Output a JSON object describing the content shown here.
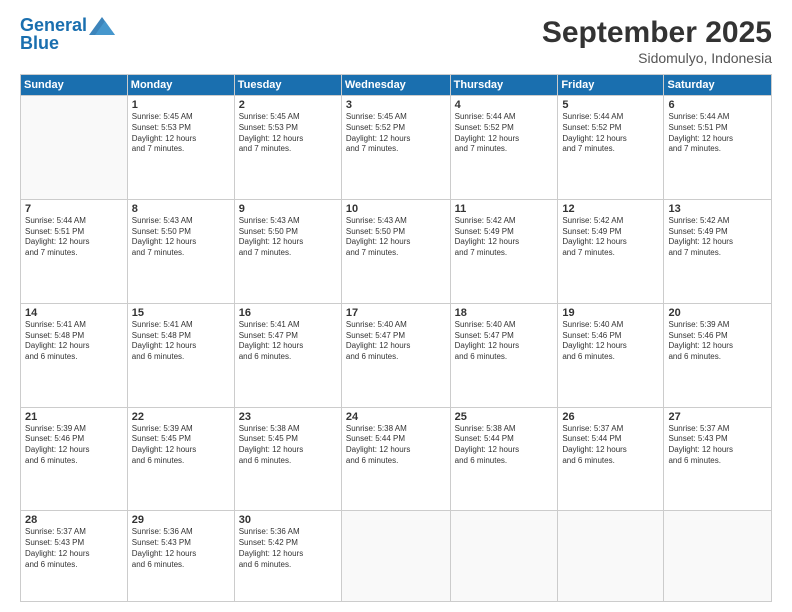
{
  "header": {
    "logo_line1": "General",
    "logo_line2": "Blue",
    "month": "September 2025",
    "location": "Sidomulyo, Indonesia"
  },
  "weekdays": [
    "Sunday",
    "Monday",
    "Tuesday",
    "Wednesday",
    "Thursday",
    "Friday",
    "Saturday"
  ],
  "weeks": [
    [
      {
        "day": "",
        "text": ""
      },
      {
        "day": "1",
        "text": "Sunrise: 5:45 AM\nSunset: 5:53 PM\nDaylight: 12 hours\nand 7 minutes."
      },
      {
        "day": "2",
        "text": "Sunrise: 5:45 AM\nSunset: 5:53 PM\nDaylight: 12 hours\nand 7 minutes."
      },
      {
        "day": "3",
        "text": "Sunrise: 5:45 AM\nSunset: 5:52 PM\nDaylight: 12 hours\nand 7 minutes."
      },
      {
        "day": "4",
        "text": "Sunrise: 5:44 AM\nSunset: 5:52 PM\nDaylight: 12 hours\nand 7 minutes."
      },
      {
        "day": "5",
        "text": "Sunrise: 5:44 AM\nSunset: 5:52 PM\nDaylight: 12 hours\nand 7 minutes."
      },
      {
        "day": "6",
        "text": "Sunrise: 5:44 AM\nSunset: 5:51 PM\nDaylight: 12 hours\nand 7 minutes."
      }
    ],
    [
      {
        "day": "7",
        "text": "Sunrise: 5:44 AM\nSunset: 5:51 PM\nDaylight: 12 hours\nand 7 minutes."
      },
      {
        "day": "8",
        "text": "Sunrise: 5:43 AM\nSunset: 5:50 PM\nDaylight: 12 hours\nand 7 minutes."
      },
      {
        "day": "9",
        "text": "Sunrise: 5:43 AM\nSunset: 5:50 PM\nDaylight: 12 hours\nand 7 minutes."
      },
      {
        "day": "10",
        "text": "Sunrise: 5:43 AM\nSunset: 5:50 PM\nDaylight: 12 hours\nand 7 minutes."
      },
      {
        "day": "11",
        "text": "Sunrise: 5:42 AM\nSunset: 5:49 PM\nDaylight: 12 hours\nand 7 minutes."
      },
      {
        "day": "12",
        "text": "Sunrise: 5:42 AM\nSunset: 5:49 PM\nDaylight: 12 hours\nand 7 minutes."
      },
      {
        "day": "13",
        "text": "Sunrise: 5:42 AM\nSunset: 5:49 PM\nDaylight: 12 hours\nand 7 minutes."
      }
    ],
    [
      {
        "day": "14",
        "text": "Sunrise: 5:41 AM\nSunset: 5:48 PM\nDaylight: 12 hours\nand 6 minutes."
      },
      {
        "day": "15",
        "text": "Sunrise: 5:41 AM\nSunset: 5:48 PM\nDaylight: 12 hours\nand 6 minutes."
      },
      {
        "day": "16",
        "text": "Sunrise: 5:41 AM\nSunset: 5:47 PM\nDaylight: 12 hours\nand 6 minutes."
      },
      {
        "day": "17",
        "text": "Sunrise: 5:40 AM\nSunset: 5:47 PM\nDaylight: 12 hours\nand 6 minutes."
      },
      {
        "day": "18",
        "text": "Sunrise: 5:40 AM\nSunset: 5:47 PM\nDaylight: 12 hours\nand 6 minutes."
      },
      {
        "day": "19",
        "text": "Sunrise: 5:40 AM\nSunset: 5:46 PM\nDaylight: 12 hours\nand 6 minutes."
      },
      {
        "day": "20",
        "text": "Sunrise: 5:39 AM\nSunset: 5:46 PM\nDaylight: 12 hours\nand 6 minutes."
      }
    ],
    [
      {
        "day": "21",
        "text": "Sunrise: 5:39 AM\nSunset: 5:46 PM\nDaylight: 12 hours\nand 6 minutes."
      },
      {
        "day": "22",
        "text": "Sunrise: 5:39 AM\nSunset: 5:45 PM\nDaylight: 12 hours\nand 6 minutes."
      },
      {
        "day": "23",
        "text": "Sunrise: 5:38 AM\nSunset: 5:45 PM\nDaylight: 12 hours\nand 6 minutes."
      },
      {
        "day": "24",
        "text": "Sunrise: 5:38 AM\nSunset: 5:44 PM\nDaylight: 12 hours\nand 6 minutes."
      },
      {
        "day": "25",
        "text": "Sunrise: 5:38 AM\nSunset: 5:44 PM\nDaylight: 12 hours\nand 6 minutes."
      },
      {
        "day": "26",
        "text": "Sunrise: 5:37 AM\nSunset: 5:44 PM\nDaylight: 12 hours\nand 6 minutes."
      },
      {
        "day": "27",
        "text": "Sunrise: 5:37 AM\nSunset: 5:43 PM\nDaylight: 12 hours\nand 6 minutes."
      }
    ],
    [
      {
        "day": "28",
        "text": "Sunrise: 5:37 AM\nSunset: 5:43 PM\nDaylight: 12 hours\nand 6 minutes."
      },
      {
        "day": "29",
        "text": "Sunrise: 5:36 AM\nSunset: 5:43 PM\nDaylight: 12 hours\nand 6 minutes."
      },
      {
        "day": "30",
        "text": "Sunrise: 5:36 AM\nSunset: 5:42 PM\nDaylight: 12 hours\nand 6 minutes."
      },
      {
        "day": "",
        "text": ""
      },
      {
        "day": "",
        "text": ""
      },
      {
        "day": "",
        "text": ""
      },
      {
        "day": "",
        "text": ""
      }
    ]
  ]
}
